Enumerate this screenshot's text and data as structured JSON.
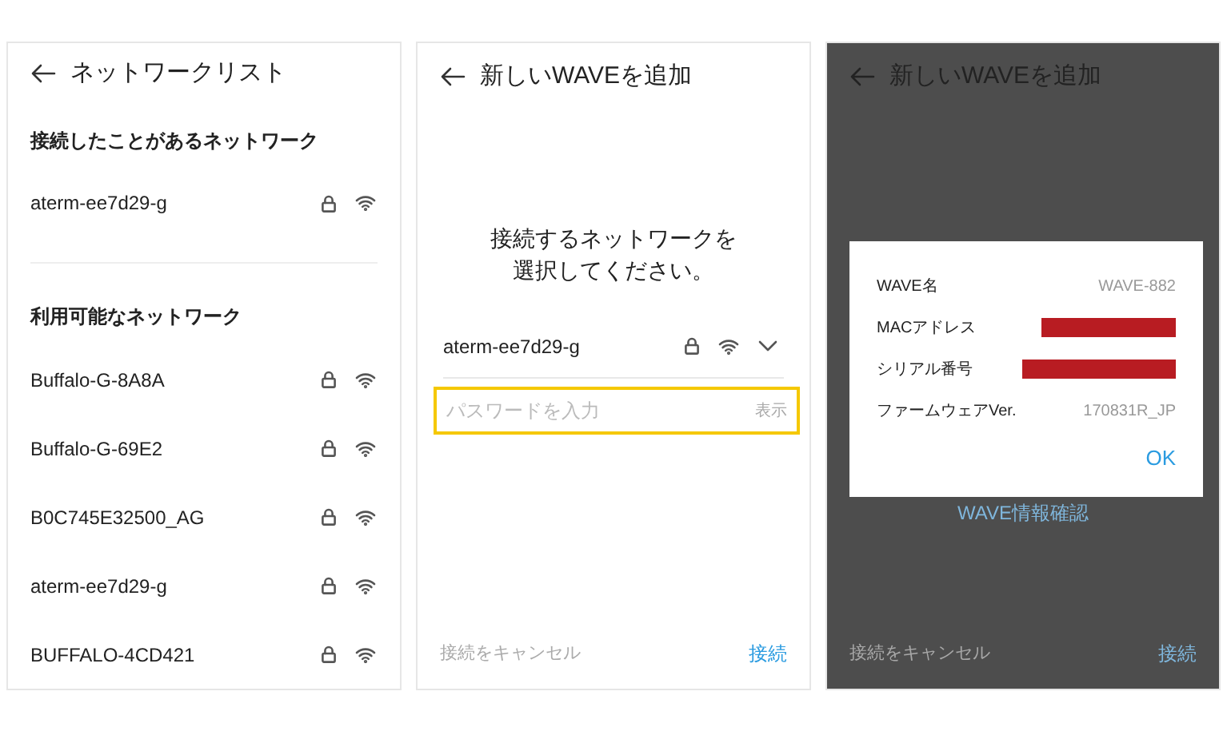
{
  "screens": [
    {
      "kind": "network_list",
      "title": "ネットワークリスト",
      "sections": [
        {
          "heading": "接続したことがあるネットワーク",
          "networks": [
            {
              "ssid": "aterm-ee7d29-g",
              "locked": true
            }
          ]
        },
        {
          "heading": "利用可能なネットワーク",
          "networks": [
            {
              "ssid": "Buffalo-G-8A8A",
              "locked": true
            },
            {
              "ssid": "Buffalo-G-69E2",
              "locked": true
            },
            {
              "ssid": "B0C745E32500_AG",
              "locked": true
            },
            {
              "ssid": "aterm-ee7d29-g",
              "locked": true
            },
            {
              "ssid": "BUFFALO-4CD421",
              "locked": true
            }
          ]
        }
      ]
    },
    {
      "kind": "add_wave",
      "title": "新しいWAVEを追加",
      "message_lines": [
        "接続するネットワークを",
        "選択してください。"
      ],
      "network": {
        "ssid": "aterm-ee7d29-g",
        "locked": true
      },
      "password": {
        "placeholder": "パスワードを入力",
        "highlighted": true,
        "toggle_label": "表示"
      },
      "cancel_label": "接続をキャンセル",
      "connect_label": "接続"
    },
    {
      "kind": "add_wave_dialog",
      "title": "新しいWAVEを追加",
      "link": "WAVE情報確認",
      "cancel_label": "接続をキャンセル",
      "connect_label": "接続",
      "dialog": {
        "rows": [
          {
            "label": "WAVE名",
            "value": "WAVE-882",
            "redacted": false
          },
          {
            "label": "MACアドレス",
            "redacted": true
          },
          {
            "label": "シリアル番号",
            "redacted": true
          },
          {
            "label": "ファームウェアVer.",
            "value": "170831R_JP",
            "redacted": false
          }
        ],
        "ok_label": "OK"
      }
    }
  ]
}
